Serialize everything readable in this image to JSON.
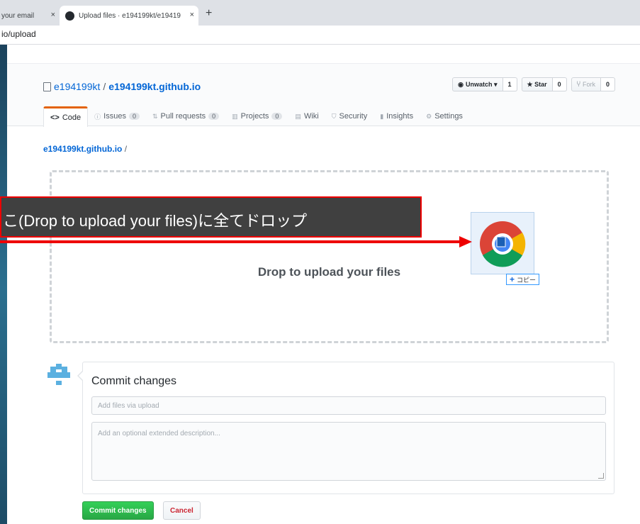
{
  "browser": {
    "tabs": [
      {
        "label": "your email",
        "active": false
      },
      {
        "label": "Upload files · e194199kt/e19419",
        "active": true
      }
    ],
    "new_tab": "+",
    "close": "×",
    "address": "io/upload"
  },
  "repo": {
    "owner": "e194199kt",
    "separator": "/",
    "name": "e194199kt.github.io"
  },
  "actions": {
    "unwatch_label": "Unwatch ▾",
    "unwatch_count": "1",
    "star_label": "★ Star",
    "star_count": "0",
    "fork_label": "Fork",
    "fork_count": "0"
  },
  "repo_tabs": [
    {
      "label": "Code",
      "icon": "code-icon",
      "count": ""
    },
    {
      "label": "Issues",
      "icon": "issue-icon",
      "count": "0"
    },
    {
      "label": "Pull requests",
      "icon": "pull-request-icon",
      "count": "0"
    },
    {
      "label": "Projects",
      "icon": "project-icon",
      "count": "0"
    },
    {
      "label": "Wiki",
      "icon": "book-icon",
      "count": ""
    },
    {
      "label": "Security",
      "icon": "shield-icon",
      "count": ""
    },
    {
      "label": "Insights",
      "icon": "graph-icon",
      "count": ""
    },
    {
      "label": "Settings",
      "icon": "gear-icon",
      "count": ""
    }
  ],
  "breadcrumb": {
    "repo": "e194199kt.github.io",
    "sep": " /"
  },
  "dropzone": {
    "text": "Drop to upload your files",
    "copy_badge": "コピー"
  },
  "commit": {
    "title": "Commit changes",
    "summary_placeholder": "Add files via upload",
    "description_placeholder": "Add an optional extended description...",
    "commit_button": "Commit changes",
    "cancel_button": "Cancel"
  },
  "annotation": {
    "callout_text": "こ(Drop to upload your files)に全てドロップ",
    "color": "#ee0000"
  }
}
